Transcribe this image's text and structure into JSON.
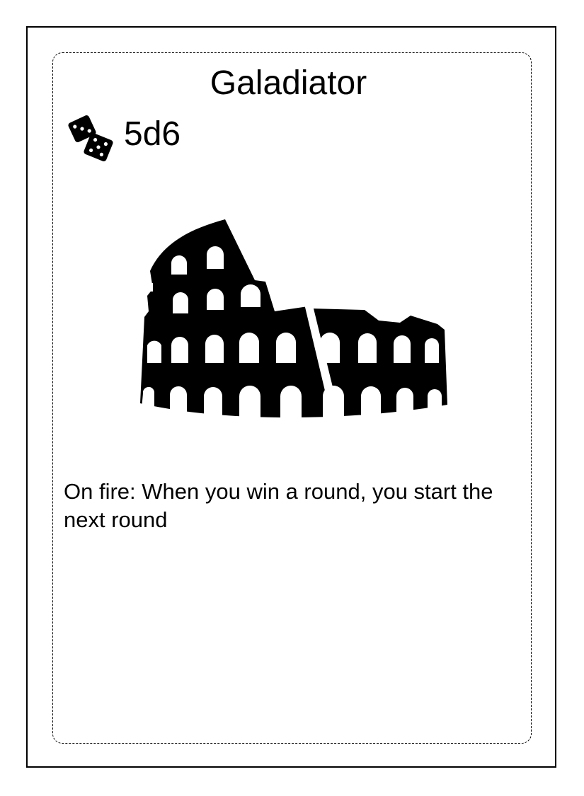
{
  "card": {
    "title": "Galadiator",
    "dice": {
      "icon": "dice-icon",
      "value": "5d6"
    },
    "illustration": "colosseum-icon",
    "ability_text": "On fire: When you win a round, you start the next round"
  }
}
